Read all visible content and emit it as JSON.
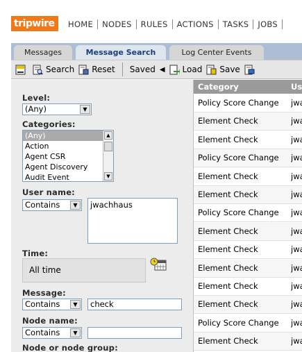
{
  "app": {
    "logo_text": "tripwire",
    "nav": [
      "HOME",
      "NODES",
      "RULES",
      "ACTIONS",
      "TASKS",
      "JOBS"
    ]
  },
  "tabs": [
    {
      "label": "Messages",
      "active": false
    },
    {
      "label": "Message Search",
      "active": true
    },
    {
      "label": "Log Center Events",
      "active": false
    }
  ],
  "toolbar": {
    "search_label": "Search",
    "reset_label": "Reset",
    "saved_label": "Saved",
    "load_label": "Load",
    "save_label": "Save"
  },
  "form": {
    "level_label": "Level:",
    "level_value": "(Any)",
    "categories_label": "Categories:",
    "categories_options": [
      "(Any)",
      "Action",
      "Agent CSR",
      "Agent Discovery",
      "Audit Event"
    ],
    "categories_selected": "(Any)",
    "username_label": "User name:",
    "username_match": "Contains",
    "username_value": "jwachhaus",
    "time_label": "Time:",
    "time_value": "All time",
    "message_label": "Message:",
    "message_match": "Contains",
    "message_value": "check",
    "nodename_label": "Node name:",
    "nodename_match": "Contains",
    "nodename_value": "",
    "nodegroup_label": "Node or node group:"
  },
  "results": {
    "columns": [
      "Category",
      "Us"
    ],
    "rows": [
      [
        "Policy Score Change",
        "jwa"
      ],
      [
        "Element Check",
        "jwa"
      ],
      [
        "Element Check",
        "jwa"
      ],
      [
        "Policy Score Change",
        "jwa"
      ],
      [
        "Element Check",
        "jwa"
      ],
      [
        "Element Check",
        "jwa"
      ],
      [
        "Policy Score Change",
        "jwa"
      ],
      [
        "Element Check",
        "jwa"
      ],
      [
        "Element Check",
        "jwa"
      ],
      [
        "Element Check",
        "jwa"
      ],
      [
        "Element Check",
        "jwa"
      ],
      [
        "Element Check",
        "jwa"
      ],
      [
        "Policy Score Change",
        "jwa"
      ],
      [
        "Element Check",
        "jwa"
      ]
    ]
  },
  "colors": {
    "brand": "#f07a1a",
    "tabbar": "#aebdd3",
    "active_tab_text": "#1b3e7a",
    "table_header": "#9a9a9a"
  }
}
